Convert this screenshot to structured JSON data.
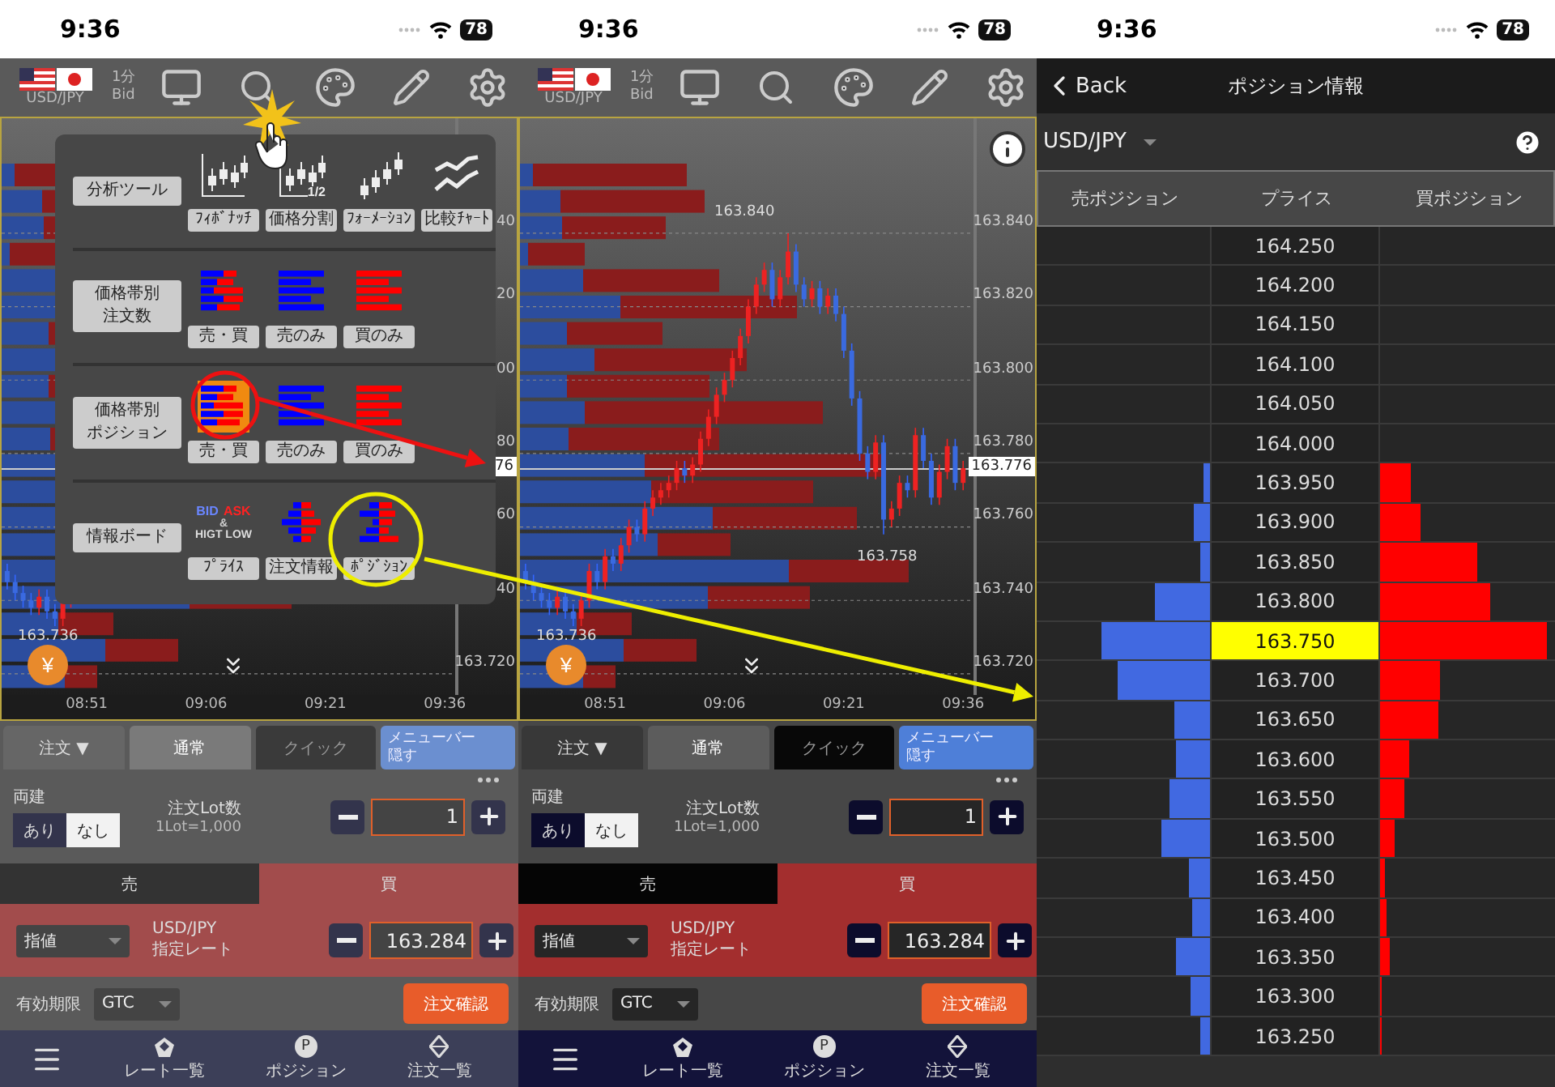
{
  "screens": [
    {
      "kind": "chart",
      "dimmed": true,
      "status_bar": {
        "time": "9:36",
        "battery": "78"
      },
      "toolbar": {
        "pair": "USD/JPY",
        "timeframe": "1分",
        "price_type": "Bid"
      },
      "chart": {
        "info_button": false,
        "axis_labels": [
          "40",
          "20",
          "00",
          "80",
          "60",
          "40",
          "163.720"
        ],
        "price_tag": "76",
        "low_label": "163.736",
        "currency_button": "¥",
        "times": [
          "08:51",
          "09:06",
          "09:21",
          "09:36"
        ]
      },
      "menu": {
        "sections": [
          {
            "label_lines": [
              "分析ツール"
            ],
            "items": [
              {
                "kind": "fib",
                "label": "ﾌｨﾎﾞﾅｯﾁ",
                "selected": false
              },
              {
                "kind": "split",
                "label": "価格分割",
                "icon_text": [
                  "1/2"
                ],
                "selected": false
              },
              {
                "kind": "formation",
                "label": "ﾌｫｰﾒｰｼｮﾝ",
                "selected": false
              },
              {
                "kind": "compare",
                "label": "比較ﾁｬｰﾄ",
                "selected": false
              }
            ]
          },
          {
            "label_lines": [
              "価格帯別",
              "注文数"
            ],
            "items": [
              {
                "kind": "bars-both",
                "label": "売・買",
                "selected": false
              },
              {
                "kind": "bars-sell",
                "label": "売のみ",
                "selected": false
              },
              {
                "kind": "bars-buy",
                "label": "買のみ",
                "selected": false
              }
            ]
          },
          {
            "label_lines": [
              "価格帯別",
              "ポジション"
            ],
            "items": [
              {
                "kind": "bars-both",
                "label": "売・買",
                "selected": true
              },
              {
                "kind": "bars-sell",
                "label": "売のみ",
                "selected": false
              },
              {
                "kind": "bars-buy",
                "label": "買のみ",
                "selected": false
              }
            ]
          },
          {
            "label_lines": [
              "情報ボード"
            ],
            "items": [
              {
                "kind": "price-board",
                "label": "ﾌﾟﾗｲｽ",
                "icon_text": [
                  "BID",
                  "ASK",
                  "&",
                  "HIGT LOW"
                ],
                "selected": false
              },
              {
                "kind": "order-board",
                "label": "注文情報",
                "selected": false
              },
              {
                "kind": "position-board",
                "label": "ﾎﾟｼﾞｼｮﾝ",
                "selected": false
              }
            ]
          }
        ]
      },
      "order_panel": {
        "tabs": [
          {
            "kind": "dropdown",
            "label": "注文 ▼",
            "selected": false
          },
          {
            "kind": "tab",
            "label": "通常",
            "selected": true
          },
          {
            "kind": "tab",
            "label": "クイック",
            "selected": false
          }
        ],
        "hide_menu_lines": [
          "メニューバー",
          "隠す"
        ],
        "hedge": {
          "label": "両建",
          "options": [
            {
              "label": "あり",
              "selected": false
            },
            {
              "label": "なし",
              "selected": true
            }
          ]
        },
        "lot": {
          "label": "注文Lot数",
          "note": "1Lot=1,000",
          "value": "1"
        },
        "sides": [
          {
            "label": "売",
            "selected": false
          },
          {
            "label": "買",
            "selected": true
          }
        ],
        "order_type": "指値",
        "pair": "USD/JPY",
        "rate_label": "指定レート",
        "rate": "163.284",
        "expiry_label": "有効期限",
        "expiry": "GTC",
        "confirm_button": "注文確認"
      },
      "nav": [
        {
          "kind": "menu"
        },
        {
          "kind": "rates",
          "label": "レート一覧"
        },
        {
          "kind": "position",
          "label": "ポジション",
          "badge": "P"
        },
        {
          "kind": "orders",
          "label": "注文一覧"
        }
      ]
    },
    {
      "kind": "chart",
      "dimmed": false,
      "status_bar": {
        "time": "9:36",
        "battery": "78"
      },
      "toolbar": {
        "pair": "USD/JPY",
        "timeframe": "1分",
        "price_type": "Bid"
      },
      "chart": {
        "info_button": true,
        "price_tag": "163.776",
        "high_label": "163.840",
        "mid_label": "163.758",
        "low_label": "163.736",
        "currency_button": "¥",
        "chart_data": {
          "type": "candlestick",
          "x": [
            521,
            522,
            523,
            524,
            525,
            526,
            527,
            528,
            529,
            530,
            531,
            532,
            533,
            534,
            535,
            536,
            537,
            538,
            539,
            540,
            541,
            542,
            543,
            544,
            545,
            546,
            547,
            548,
            549,
            550,
            551,
            552,
            553,
            554,
            555,
            556,
            557,
            558,
            559,
            560,
            561,
            562,
            563,
            564,
            565,
            566,
            567,
            568,
            569,
            570,
            571,
            572,
            573,
            574,
            575,
            576
          ],
          "xlim": [
            520.3,
            577.3
          ],
          "ylim": [
            163.7138,
            163.8713
          ],
          "grid": true,
          "xticks": [
            {
              "value": 531,
              "label": "08:51"
            },
            {
              "value": 546,
              "label": "09:06"
            },
            {
              "value": 561,
              "label": "09:21"
            },
            {
              "value": 576,
              "label": "09:36"
            }
          ],
          "yticks": [
            {
              "value": 163.84,
              "label": "163.840"
            },
            {
              "value": 163.82,
              "label": "163.820"
            },
            {
              "value": 163.8,
              "label": "163.800"
            },
            {
              "value": 163.78,
              "label": "163.780"
            },
            {
              "value": 163.76,
              "label": "163.760"
            },
            {
              "value": 163.74,
              "label": "163.740"
            },
            {
              "value": 163.72,
              "label": "163.720"
            }
          ],
          "ohlc": [
            [
              163.748,
              163.75,
              163.743,
              163.745
            ],
            [
              163.745,
              163.747,
              163.74,
              163.742
            ],
            [
              163.742,
              163.744,
              163.738,
              163.74
            ],
            [
              163.74,
              163.742,
              163.736,
              163.738
            ],
            [
              163.738,
              163.743,
              163.736,
              163.741
            ],
            [
              163.741,
              163.743,
              163.735,
              163.737
            ],
            [
              163.737,
              163.739,
              163.733,
              163.735
            ],
            [
              163.735,
              163.742,
              163.733,
              163.74
            ],
            [
              163.74,
              163.75,
              163.738,
              163.748
            ],
            [
              163.748,
              163.75,
              163.743,
              163.745
            ],
            [
              163.745,
              163.754,
              163.743,
              163.752
            ],
            [
              163.752,
              163.754,
              163.748,
              163.75
            ],
            [
              163.75,
              163.757,
              163.748,
              163.755
            ],
            [
              163.755,
              163.762,
              163.753,
              163.76
            ],
            [
              163.76,
              163.762,
              163.756,
              163.758
            ],
            [
              163.758,
              163.767,
              163.756,
              163.765
            ],
            [
              163.765,
              163.77,
              163.763,
              163.768
            ],
            [
              163.768,
              163.772,
              163.766,
              163.77
            ],
            [
              163.77,
              163.774,
              163.768,
              163.772
            ],
            [
              163.772,
              163.778,
              163.77,
              163.776
            ],
            [
              163.776,
              163.778,
              163.772,
              163.774
            ],
            [
              163.774,
              163.779,
              163.772,
              163.777
            ],
            [
              163.777,
              163.786,
              163.775,
              163.784
            ],
            [
              163.784,
              163.792,
              163.782,
              163.79
            ],
            [
              163.79,
              163.798,
              163.788,
              163.796
            ],
            [
              163.796,
              163.802,
              163.794,
              163.8
            ],
            [
              163.8,
              163.808,
              163.798,
              163.806
            ],
            [
              163.806,
              163.814,
              163.804,
              163.812
            ],
            [
              163.812,
              163.822,
              163.81,
              163.82
            ],
            [
              163.82,
              163.828,
              163.818,
              163.826
            ],
            [
              163.826,
              163.832,
              163.824,
              163.83
            ],
            [
              163.83,
              163.832,
              163.82,
              163.822
            ],
            [
              163.822,
              163.83,
              163.82,
              163.828
            ],
            [
              163.828,
              163.84,
              163.826,
              163.835
            ],
            [
              163.835,
              163.837,
              163.824,
              163.826
            ],
            [
              163.826,
              163.828,
              163.82,
              163.822
            ],
            [
              163.822,
              163.827,
              163.82,
              163.825
            ],
            [
              163.825,
              163.827,
              163.818,
              163.82
            ],
            [
              163.82,
              163.825,
              163.818,
              163.823
            ],
            [
              163.823,
              163.825,
              163.816,
              163.818
            ],
            [
              163.818,
              163.82,
              163.806,
              163.808
            ],
            [
              163.808,
              163.81,
              163.793,
              163.795
            ],
            [
              163.795,
              163.797,
              163.778,
              163.78
            ],
            [
              163.78,
              163.782,
              163.773,
              163.775
            ],
            [
              163.775,
              163.785,
              163.773,
              163.783
            ],
            [
              163.783,
              163.785,
              163.758,
              163.762
            ],
            [
              163.762,
              163.767,
              163.76,
              163.765
            ],
            [
              163.765,
              163.774,
              163.763,
              163.772
            ],
            [
              163.772,
              163.774,
              163.768,
              163.77
            ],
            [
              163.77,
              163.787,
              163.768,
              163.785
            ],
            [
              163.785,
              163.787,
              163.776,
              163.778
            ],
            [
              163.778,
              163.78,
              163.766,
              163.768
            ],
            [
              163.768,
              163.777,
              163.766,
              163.775
            ],
            [
              163.775,
              163.784,
              163.773,
              163.782
            ],
            [
              163.782,
              163.784,
              163.77,
              163.772
            ],
            [
              163.772,
              163.778,
              163.77,
              163.776
            ]
          ]
        }
      },
      "order_panel": {
        "tabs": [
          {
            "kind": "dropdown",
            "label": "注文 ▼",
            "selected": false
          },
          {
            "kind": "tab",
            "label": "通常",
            "selected": true
          },
          {
            "kind": "tab",
            "label": "クイック",
            "selected": false
          }
        ],
        "hide_menu_lines": [
          "メニューバー",
          "隠す"
        ],
        "hedge": {
          "label": "両建",
          "options": [
            {
              "label": "あり",
              "selected": false
            },
            {
              "label": "なし",
              "selected": true
            }
          ]
        },
        "lot": {
          "label": "注文Lot数",
          "note": "1Lot=1,000",
          "value": "1"
        },
        "sides": [
          {
            "label": "売",
            "selected": false
          },
          {
            "label": "買",
            "selected": true
          }
        ],
        "order_type": "指値",
        "pair": "USD/JPY",
        "rate_label": "指定レート",
        "rate": "163.284",
        "expiry_label": "有効期限",
        "expiry": "GTC",
        "confirm_button": "注文確認"
      },
      "nav": [
        {
          "kind": "menu"
        },
        {
          "kind": "rates",
          "label": "レート一覧"
        },
        {
          "kind": "position",
          "label": "ポジション",
          "badge": "P"
        },
        {
          "kind": "orders",
          "label": "注文一覧"
        }
      ]
    },
    {
      "kind": "positions",
      "status_bar": {
        "time": "9:36",
        "battery": "78"
      },
      "header": {
        "back": "Back",
        "title": "ポジション情報"
      },
      "pair": "USD/JPY",
      "columns": [
        "売ポジション",
        "プライス",
        "買ポジション"
      ],
      "rows": [
        {
          "price": "164.250",
          "highlighted": false
        },
        {
          "price": "164.200",
          "highlighted": false
        },
        {
          "price": "164.150",
          "highlighted": false
        },
        {
          "price": "164.100",
          "highlighted": false
        },
        {
          "price": "164.050",
          "highlighted": false
        },
        {
          "price": "164.000",
          "highlighted": false
        },
        {
          "price": "163.950",
          "sell": {
            "level": 0.04
          },
          "buy": {
            "level": 0.18
          },
          "highlighted": false
        },
        {
          "price": "163.900",
          "sell": {
            "level": 0.09
          },
          "buy": {
            "level": 0.23
          },
          "highlighted": false
        },
        {
          "price": "163.850",
          "sell": {
            "level": 0.06
          },
          "buy": {
            "level": 0.56
          },
          "highlighted": false
        },
        {
          "price": "163.800",
          "sell": {
            "level": 0.32
          },
          "buy": {
            "level": 0.63
          },
          "highlighted": false
        },
        {
          "price": "163.750",
          "sell": {
            "level": 0.63
          },
          "buy": {
            "level": 0.95
          },
          "highlighted": true
        },
        {
          "price": "163.700",
          "sell": {
            "level": 0.53
          },
          "buy": {
            "level": 0.34
          },
          "highlighted": false
        },
        {
          "price": "163.650",
          "sell": {
            "level": 0.21
          },
          "buy": {
            "level": 0.33
          },
          "highlighted": false
        },
        {
          "price": "163.600",
          "sell": {
            "level": 0.2
          },
          "buy": {
            "level": 0.17
          },
          "highlighted": false
        },
        {
          "price": "163.550",
          "sell": {
            "level": 0.23
          },
          "buy": {
            "level": 0.14
          },
          "highlighted": false
        },
        {
          "price": "163.500",
          "sell": {
            "level": 0.28
          },
          "buy": {
            "level": 0.08
          },
          "highlighted": false
        },
        {
          "price": "163.450",
          "sell": {
            "level": 0.12
          },
          "buy": {
            "level": 0.03
          },
          "highlighted": false
        },
        {
          "price": "163.400",
          "sell": {
            "level": 0.1
          },
          "buy": {
            "level": 0.04
          },
          "highlighted": false
        },
        {
          "price": "163.350",
          "sell": {
            "level": 0.2
          },
          "buy": {
            "level": 0.06
          },
          "highlighted": false
        },
        {
          "price": "163.300",
          "sell": {
            "level": 0.11
          },
          "buy": {
            "level": 0.01
          },
          "highlighted": false
        },
        {
          "price": "163.250",
          "sell": {
            "level": 0.06
          },
          "buy": {
            "level": 0.01
          },
          "highlighted": false
        }
      ]
    }
  ]
}
